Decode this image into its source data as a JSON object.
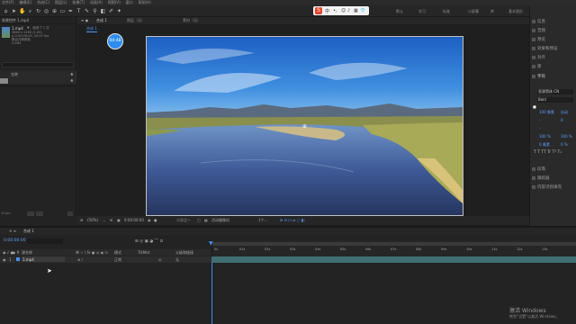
{
  "menu": [
    "文件(F)",
    "编辑(E)",
    "合成(C)",
    "图层(L)",
    "效果(T)",
    "动画(A)",
    "视图(V)",
    "窗口",
    "帮助(H)"
  ],
  "workspace": [
    "默认",
    "学习",
    "标准",
    "小屏幕",
    "库",
    "基本图形"
  ],
  "project": {
    "title": "效果控件 1.mp4",
    "footage_name": "1.mp4",
    "footage_meta1": "▼，使用了 1 次",
    "footage_meta2": "3840 x 2160 (1.00)",
    "footage_meta3": "Δ 0:00:06:26, 29.97 fps",
    "footage_meta4": "数百万种颜色",
    "footage_meta5": "H.264",
    "search_placeholder": "",
    "column_name": "名称",
    "item_name": ""
  },
  "comp": {
    "tab_label": "合成 1",
    "breadcrumb": "合成 1",
    "layer_panel": "图层（无）",
    "footage_panel": "素材（无）",
    "zoom": "(50%)",
    "time": "0:00:00:00",
    "resolution": "二分之一",
    "camera": "活动摄像机",
    "views": "1个..."
  },
  "recording_badge": "00:48",
  "right_panel": {
    "items": [
      "信息",
      "音频",
      "预览",
      "效果和预设",
      "对齐",
      "库",
      "字符",
      "段落",
      "跟踪器",
      "内容识别填充"
    ],
    "font_name": "思源黑体 CN",
    "font_style": "Bold",
    "size_value": "100 像素",
    "leading_value": "自动",
    "tracking_value": "0",
    "stroke_value": "-",
    "scale_v": "100 %",
    "scale_h": "100 %",
    "baseline": "0 像素",
    "tsume": "0 %"
  },
  "ime": {
    "label": "中"
  },
  "timeline": {
    "tab_label": "合成 1",
    "time": "0:00:00:00",
    "col_source": "源名称",
    "col_mode": "模式",
    "col_trkmat": "TrkMat",
    "col_parent": "父级和链接",
    "layer_index": "1",
    "layer_name": "1.mp4",
    "layer_mode": "正常",
    "layer_parent": "无",
    "ruler": [
      "0s",
      "01s",
      "02s",
      "03s",
      "04s",
      "05s",
      "06s",
      "07s",
      "08s",
      "09s",
      "10s",
      "11s",
      "12s",
      "13s"
    ]
  },
  "watermark": {
    "line1": "激活 Windows",
    "line2": "转到“设置”以激活 Windows。"
  },
  "colors": {
    "accent_blue": "#2d8cf0",
    "timeline_bar": "#3f6e73",
    "playhead": "#4a8cff"
  }
}
